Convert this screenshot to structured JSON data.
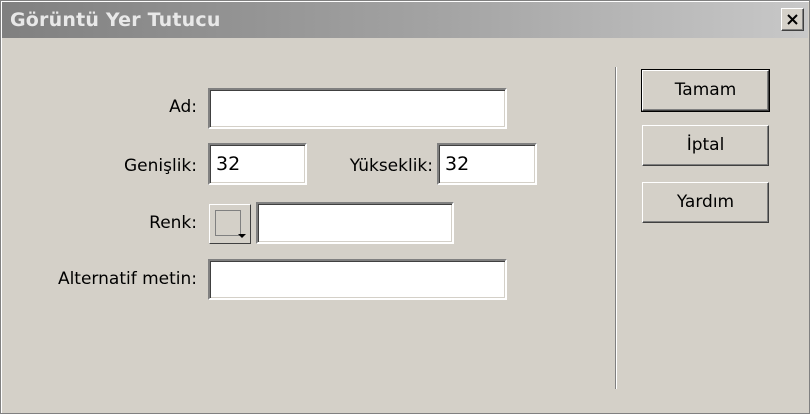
{
  "window": {
    "title": "Görüntü Yer Tutucu",
    "close_glyph": "✕"
  },
  "form": {
    "name_label": "Ad:",
    "name_value": "",
    "width_label": "Genişlik:",
    "width_value": "32",
    "height_label": "Yükseklik:",
    "height_value": "32",
    "color_label": "Renk:",
    "color_value": "",
    "alt_label": "Alternatif metin:",
    "alt_value": ""
  },
  "buttons": {
    "ok": "Tamam",
    "cancel": "İptal",
    "help": "Yardım"
  },
  "icons": {
    "close": "close-icon",
    "color_picker": "color-picker-icon"
  }
}
